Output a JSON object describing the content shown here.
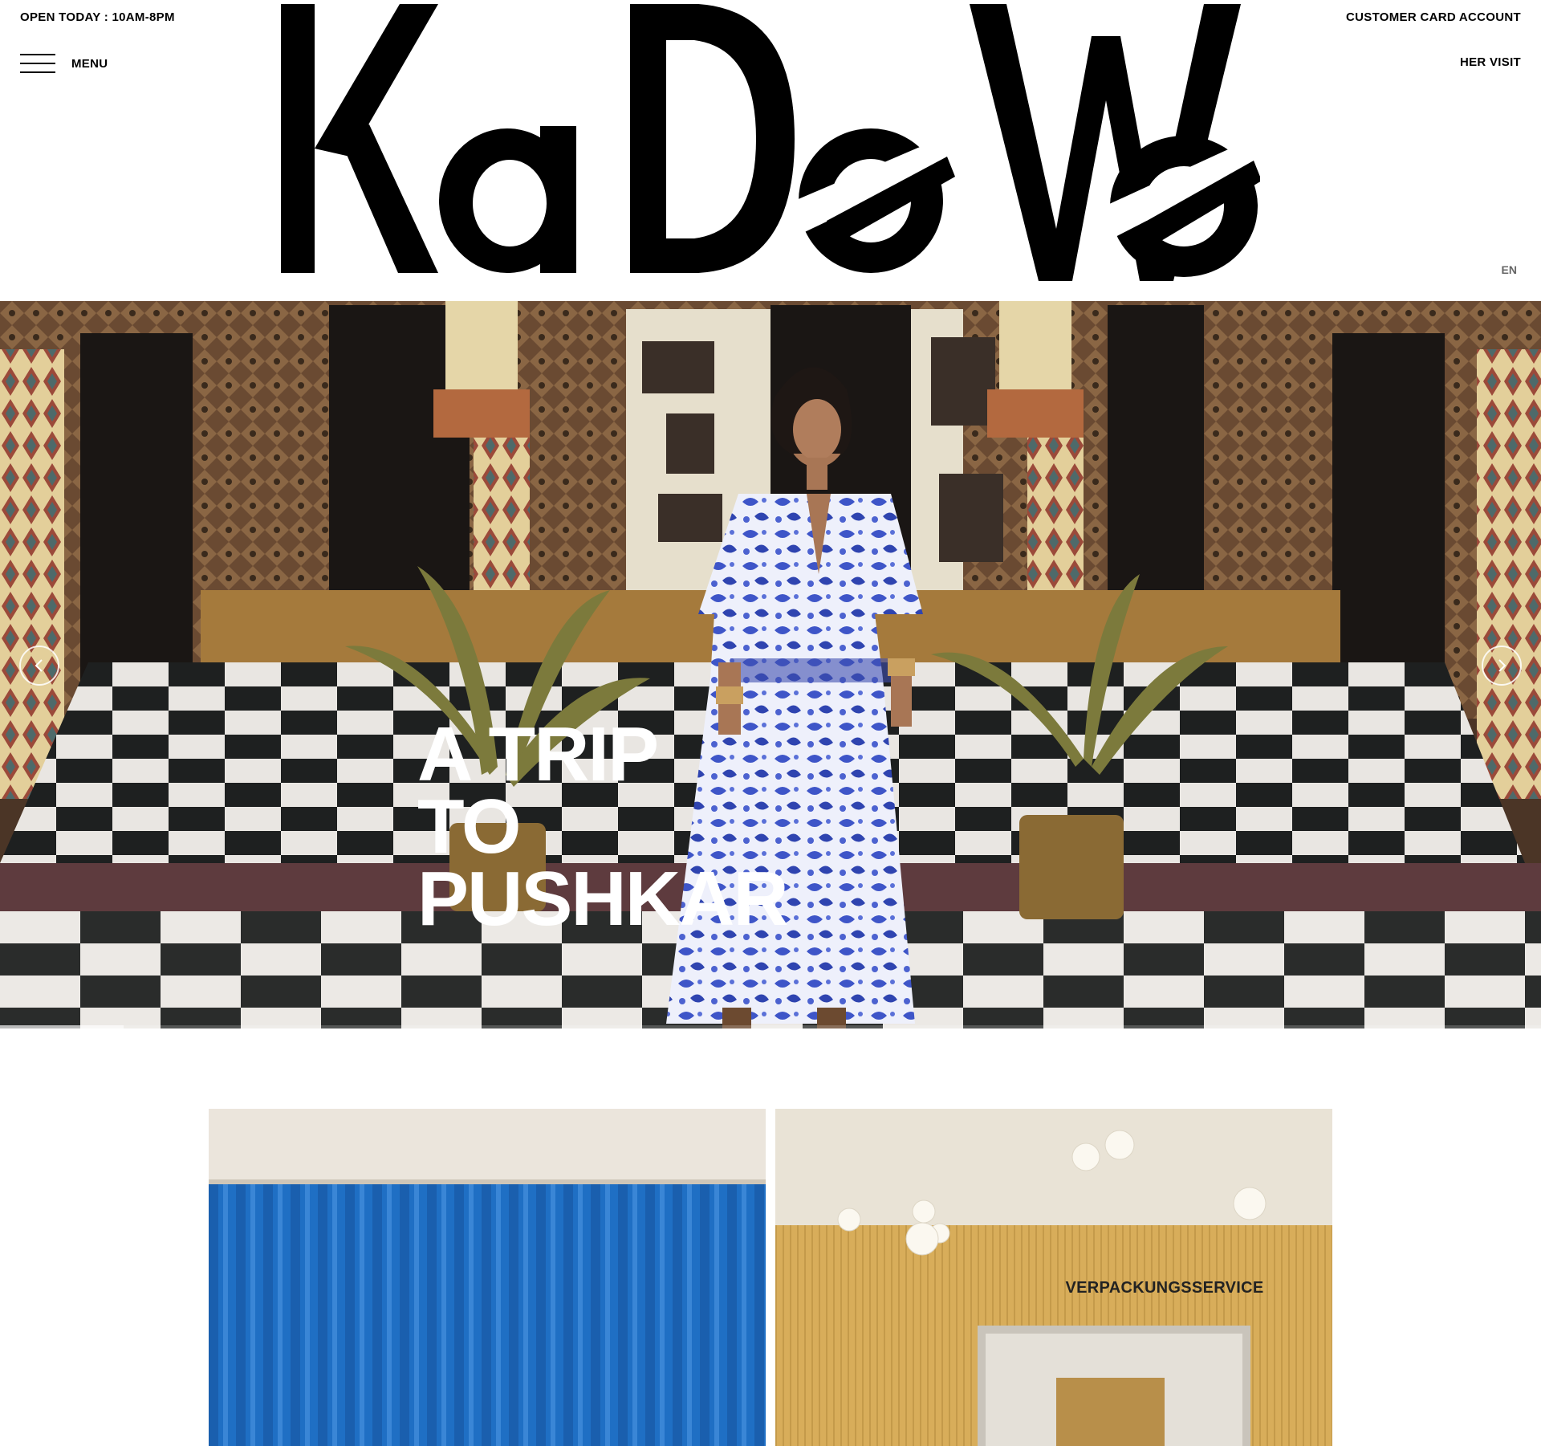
{
  "header": {
    "opening_hours": "OPEN TODAY : 10AM-8PM",
    "customer_card": "CUSTOMER CARD ACCOUNT",
    "menu_label": "MENU",
    "visit_label": "HER VISIT",
    "language": "EN",
    "logo_text": "KaDeWe"
  },
  "hero": {
    "title_lines": [
      "A TRIP",
      "TO",
      "PUSHKAR"
    ],
    "progress": 0.08
  },
  "tiles": [
    {
      "name": "blue-curtain-tile"
    },
    {
      "name": "packaging-service-tile",
      "sign": "VERPACKUNGSSERVICE"
    }
  ],
  "colors": {
    "text": "#000000",
    "hero_title": "#ffffff",
    "curtain_blue": "#1f6fc4",
    "wall_yellow": "#d8ad5a"
  }
}
